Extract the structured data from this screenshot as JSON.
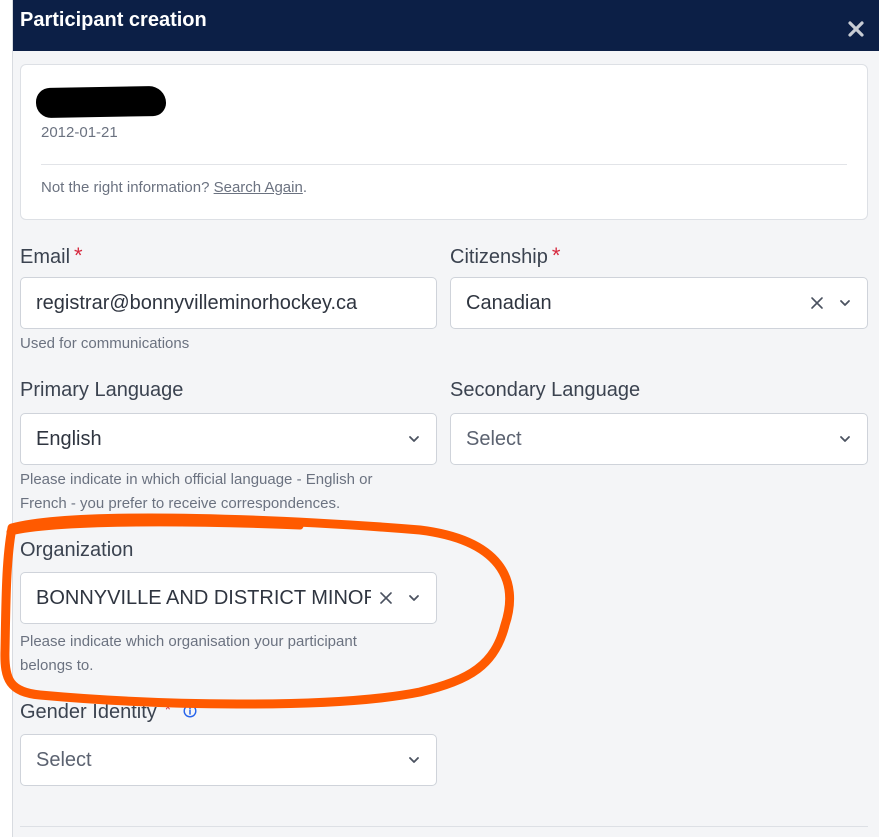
{
  "header": {
    "title": "Participant creation"
  },
  "participant": {
    "dob": "2012-01-21",
    "hint_text": "Not the right information?",
    "search_again": "Search Again",
    "period": "."
  },
  "email": {
    "label": "Email",
    "value": "registrar@bonnyvilleminorhockey.ca",
    "help": "Used for communications"
  },
  "citizenship": {
    "label": "Citizenship",
    "value": "Canadian"
  },
  "primary_language": {
    "label": "Primary Language",
    "value": "English",
    "help_line1": "Please indicate in which official language - English or",
    "help_line2": "French - you prefer to receive correspondences."
  },
  "secondary_language": {
    "label": "Secondary Language",
    "placeholder": "Select"
  },
  "organization": {
    "label": "Organization",
    "value": "BONNYVILLE AND DISTRICT MINOR HOCKEY",
    "help_line1": "Please indicate which organisation your participant",
    "help_line2": "belongs to."
  },
  "gender_identity": {
    "label": "Gender Identity",
    "placeholder": "Select"
  },
  "required_mark": "*",
  "colors": {
    "header_bg": "#0c1f46",
    "required": "#d6293e",
    "annotation": "#ff5a00",
    "info": "#2563eb"
  },
  "icons": [
    "close-icon",
    "clear-icon",
    "chevron-down-icon",
    "info-icon"
  ]
}
